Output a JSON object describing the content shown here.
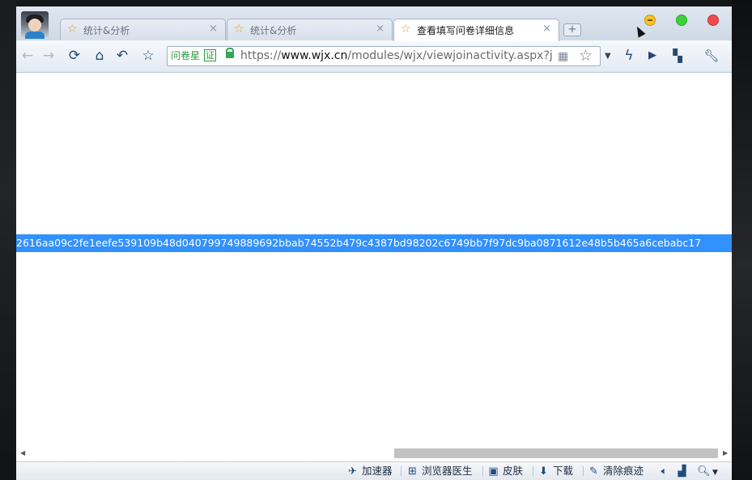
{
  "tabs": [
    {
      "label": "统计&分析",
      "icon": "star-icon"
    },
    {
      "label": "统计&分析",
      "icon": "star-icon"
    },
    {
      "label": "查看填写问卷详细信息",
      "icon": "star-icon",
      "active": true
    }
  ],
  "tab_close_glyph": "×",
  "new_tab_glyph": "+",
  "address": {
    "site_label": "问卷星",
    "cert_badge": "证",
    "url_prefix": "https://",
    "url_host": "www.wjx.cn",
    "url_path": "/modules/wjx/viewjoinactivity.aspx?joi"
  },
  "selected_text": "2616aa09c2fe1eefe539109b48d040799749889692bbab74552b479c4387bd98202c6749bb7f97dc9ba0871612e48b5b465a6cebabc17",
  "status_bar": {
    "accelerator": "加速器",
    "doctor": "浏览器医生",
    "skin": "皮肤",
    "download": "下载",
    "clear": "清除痕迹"
  },
  "colors": {
    "selection": "#3390ff",
    "window_min": "#f6c12c",
    "window_max": "#3ed13c",
    "window_close": "#ee4a4f",
    "secure_green": "#2b9a3d"
  }
}
